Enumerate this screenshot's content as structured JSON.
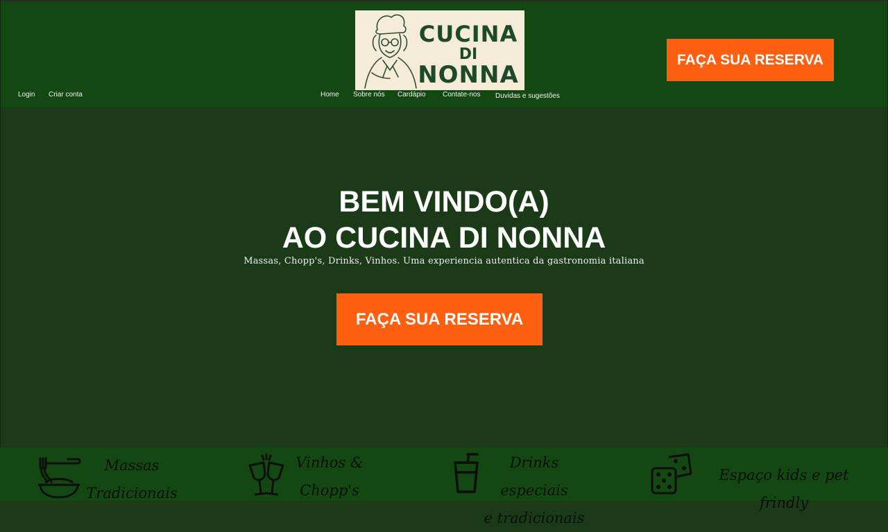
{
  "header": {
    "logo": {
      "line1": "CUCINA",
      "line2": "DI",
      "line3": "NONNA",
      "icon": "grandma-chef-icon"
    },
    "cta_label": "FAÇA SUA RESERVA",
    "auth": {
      "login": "Login",
      "signup": "Criar conta"
    },
    "nav": [
      {
        "label": "Home"
      },
      {
        "label": "Sobre nós"
      },
      {
        "label": "Cardápio"
      },
      {
        "label": "Contate-nos"
      },
      {
        "label": "Duvidas e sugestões"
      }
    ]
  },
  "hero": {
    "title_line1": "BEM VINDO(A)",
    "title_line2": "AO CUCINA DI NONNA",
    "subtitle": "Massas, Chopp's, Drinks, Vinhos. Uma experiencia autentica da gastronomia italiana",
    "cta_label": "FAÇA SUA RESERVA"
  },
  "features": [
    {
      "icon": "pasta-bowl-icon",
      "line1": "Massas",
      "line2": "Tradicionais"
    },
    {
      "icon": "wine-toast-icon",
      "line1": "Vinhos &",
      "line2": "Chopp's"
    },
    {
      "icon": "drink-cup-icon",
      "line1": "Drinks especiais",
      "line2": "e tradicionais"
    },
    {
      "icon": "dice-icon",
      "line1": "Espaço kids e pet frindly",
      "line2": ""
    }
  ],
  "colors": {
    "header_bg": "#134813",
    "hero_bg": "#1b3a18",
    "accent": "#ff5f10",
    "logo_bg": "#f4ecd6",
    "logo_text": "#1d4a2a"
  }
}
